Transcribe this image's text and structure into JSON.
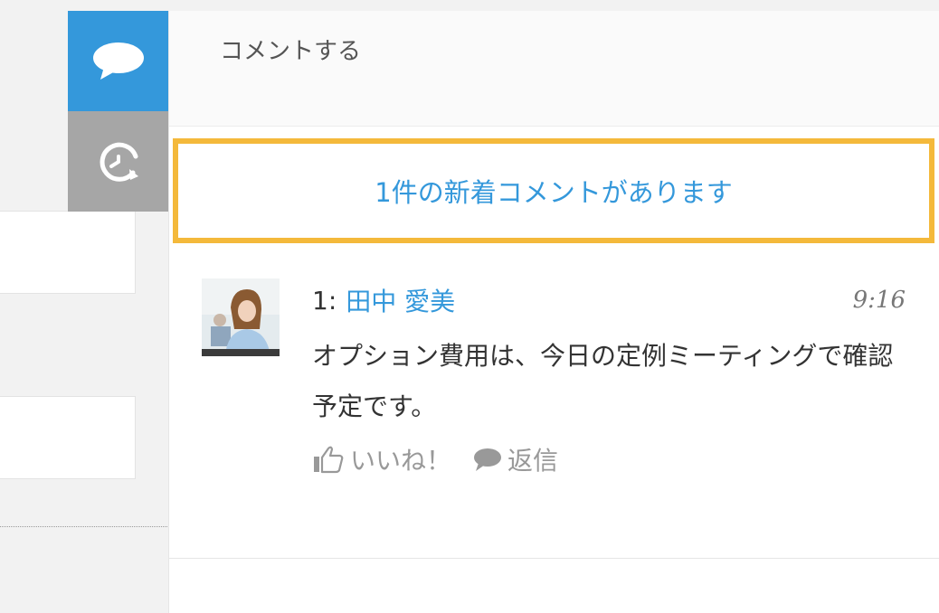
{
  "sidebar_tabs": {
    "comment_icon": "speech-bubble-icon",
    "history_icon": "history-clock-icon"
  },
  "comment_input": {
    "placeholder": "コメントする"
  },
  "new_comment_banner": {
    "text": "1件の新着コメントがあります"
  },
  "comments": [
    {
      "number": "1:",
      "author": "田中 愛美",
      "time": "9:16",
      "body": "オプション費用は、今日の定例ミーティングで確認予定です。",
      "like_label": "いいね！",
      "reply_label": "返信"
    }
  ],
  "colors": {
    "accent_blue": "#3498db",
    "highlight_border": "#f4b93b",
    "tab_inactive": "#a6a6a6"
  }
}
